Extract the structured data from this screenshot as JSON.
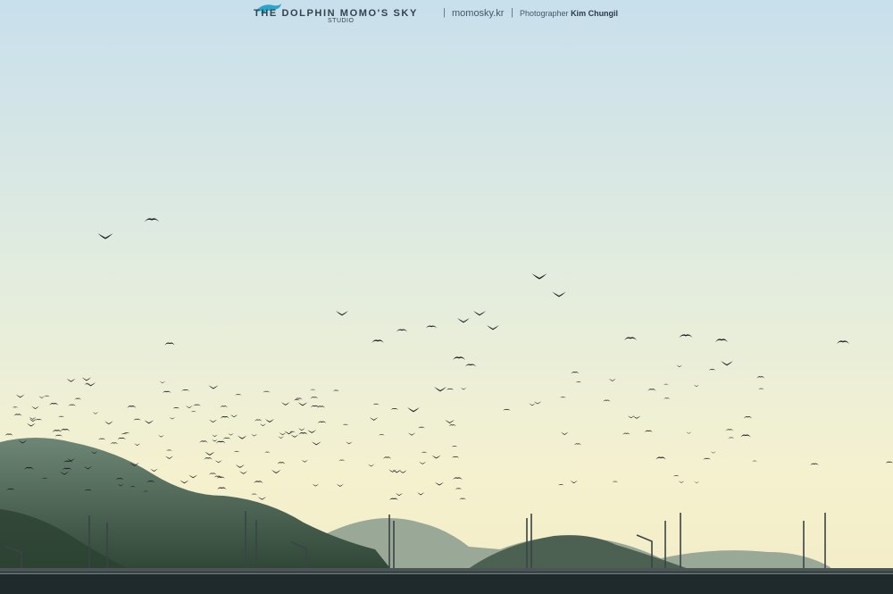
{
  "watermark": {
    "studio": "THE DOLPHIN MOMO'S SKY",
    "studio_sub": "STUDIO",
    "separator": "|",
    "site": "momosky.kr",
    "credit_prefix": "Photographer",
    "credit_name": "Kim Chungil",
    "logo_icon": "dolphin-icon",
    "logo_color": "#2aa6c9"
  },
  "scene": {
    "sky_top_color": "#cfe3ee",
    "sky_bottom_color": "#f3f0cf",
    "mountain_color": "#3e5a48",
    "far_mountain_color": "#6f8378",
    "bridge_color": "#1f2a2c",
    "bird_color": "#1a1f22"
  }
}
